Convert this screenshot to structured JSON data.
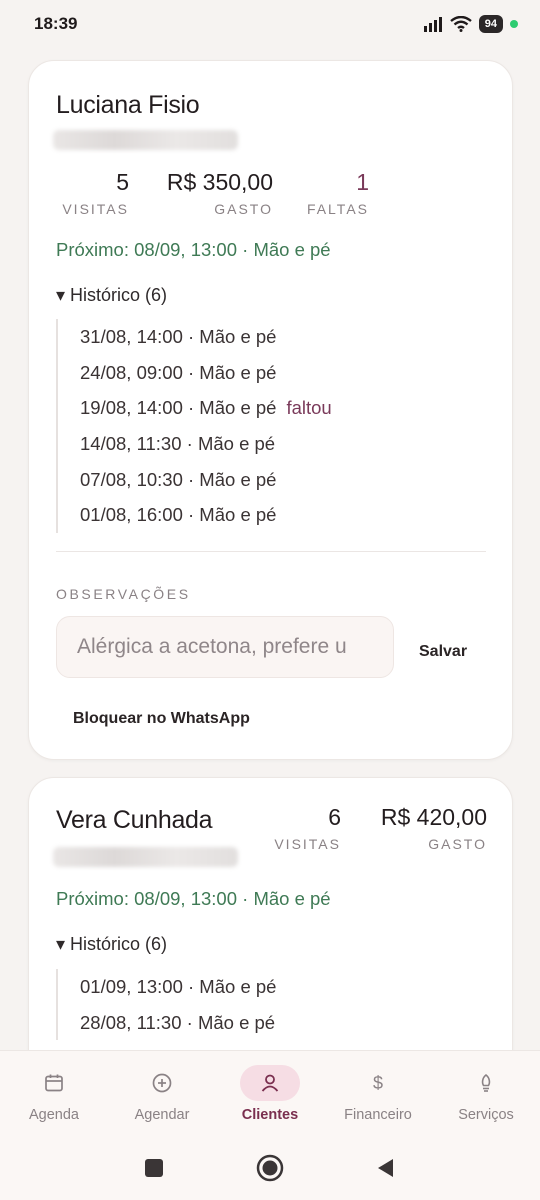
{
  "status": {
    "time": "18:39",
    "battery": "94"
  },
  "clients": [
    {
      "name": "Luciana Fisio",
      "stats": {
        "visitas_value": "5",
        "visitas_label": "VISITAS",
        "gasto_value": "R$ 350,00",
        "gasto_label": "GASTO",
        "faltas_value": "1",
        "faltas_label": "FALTAS"
      },
      "next": "Próximo: 08/09, 13:00 · Mão e pé",
      "history_toggle": "▾ Histórico (6)",
      "history": [
        {
          "text": "31/08, 14:00 · Mão e pé",
          "tag": ""
        },
        {
          "text": "24/08, 09:00 · Mão e pé",
          "tag": ""
        },
        {
          "text": "19/08, 14:00 · Mão e pé",
          "tag": "faltou"
        },
        {
          "text": "14/08, 11:30 · Mão e pé",
          "tag": ""
        },
        {
          "text": "07/08, 10:30 · Mão e pé",
          "tag": ""
        },
        {
          "text": "01/08, 16:00 · Mão e pé",
          "tag": ""
        }
      ],
      "obs_label": "OBSERVAÇÕES",
      "obs_value": "Alérgica a acetona, prefere u",
      "save_label": "Salvar",
      "block_label": "Bloquear no WhatsApp"
    },
    {
      "name": "Vera Cunhada",
      "stats": {
        "visitas_value": "6",
        "visitas_label": "VISITAS",
        "gasto_value": "R$ 420,00",
        "gasto_label": "GASTO"
      },
      "next": "Próximo: 08/09, 13:00 · Mão e pé",
      "history_toggle": "▾ Histórico (6)",
      "history": [
        {
          "text": "01/09, 13:00 · Mão e pé"
        },
        {
          "text": "28/08, 11:30 · Mão e pé"
        }
      ]
    }
  ],
  "nav": [
    {
      "label": "Agenda",
      "icon": "calendar-icon"
    },
    {
      "label": "Agendar",
      "icon": "plus-circle-icon"
    },
    {
      "label": "Clientes",
      "icon": "person-icon",
      "active": true
    },
    {
      "label": "Financeiro",
      "icon": "dollar-icon"
    },
    {
      "label": "Serviços",
      "icon": "bulb-icon"
    }
  ],
  "colors": {
    "accent": "#7a2f4f",
    "green": "#3f7a55",
    "active_bg": "#f6dde4"
  }
}
